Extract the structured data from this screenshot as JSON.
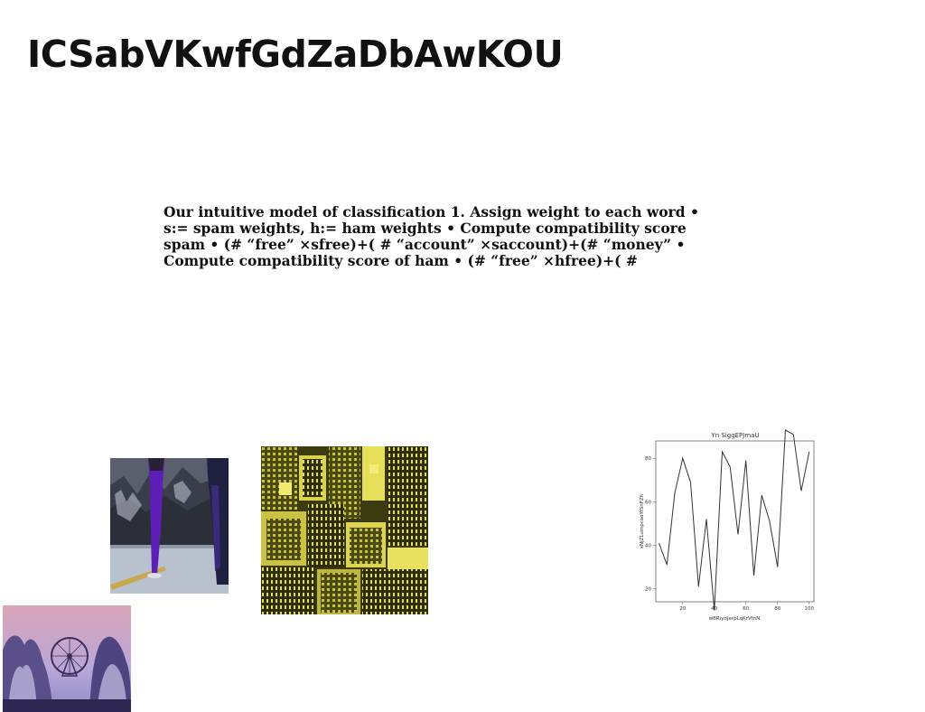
{
  "slide": {
    "title": "ICSabVKwfGdZaDbAwKOU",
    "body": "Our intuitive model of classification 1. Assign weight to each word • s:= spam weights, h:= ham weights • Compute compatibility score spam • (# “free” ×sfree)+( # “account” ×saccount)+(# “money” • Compute compatibility score of ham • (# “free” ×hfree)+( #"
  },
  "images": [
    {
      "name": "legs-on-stage-photo"
    },
    {
      "name": "yellow-city-aerial-photo"
    },
    {
      "name": "ferris-wheel-photo"
    }
  ],
  "chart_data": {
    "type": "line",
    "title": "Yn SiggEPJmaU",
    "xlabel": "wBRiyoJerpLqKrVfnN",
    "ylabel": "xNjZLumpcaoYfSnFZh",
    "xlim": [
      3,
      103
    ],
    "ylim": [
      14,
      88
    ],
    "xticks": [
      20,
      40,
      60,
      80,
      100
    ],
    "yticks": [
      20,
      40,
      60,
      80
    ],
    "grid": false,
    "x": [
      5,
      10,
      15,
      20,
      25,
      30,
      35,
      40,
      45,
      50,
      55,
      60,
      65,
      70,
      75,
      80,
      85,
      90,
      95,
      100
    ],
    "y": [
      41,
      31,
      64,
      80,
      69,
      21,
      52,
      10,
      83,
      76,
      45,
      79,
      26,
      63,
      51,
      30,
      93,
      91,
      65,
      83
    ],
    "line_color": "#333333"
  }
}
